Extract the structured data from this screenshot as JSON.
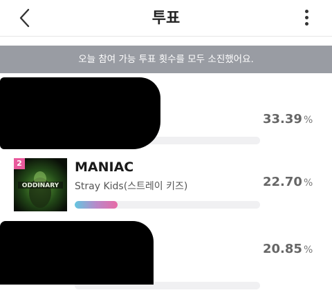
{
  "header": {
    "title": "투표"
  },
  "notice": {
    "text": "오늘 참여 가능 투표 횟수를 모두 소진했어요."
  },
  "entries": [
    {
      "song": "",
      "artist": "",
      "percent": "33.39",
      "fill": 0.0
    },
    {
      "rank": "2",
      "song": "MANIAC",
      "artist": "Stray Kids(스트레이 키즈)",
      "percent": "22.70",
      "fill": 0.23
    },
    {
      "song": "",
      "artist": "",
      "percent": "20.85",
      "fill": 0.0
    }
  ],
  "units": {
    "percent": "%"
  },
  "cover": {
    "label": "ODDINARY"
  },
  "colors": {
    "rank_badge": "#e85a9c",
    "notice_bg": "#999ca3",
    "bar_start": "#63c6e0",
    "bar_end": "#e86aa6"
  }
}
